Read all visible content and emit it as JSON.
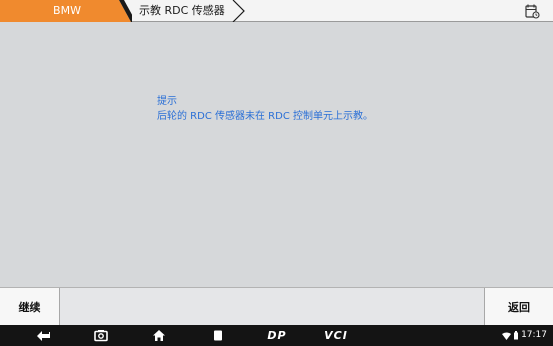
{
  "header": {
    "brand_label": "BMW",
    "page_title": "示教 RDC 传感器",
    "brand_color": "#f08a2e"
  },
  "message": {
    "title": "提示",
    "body": "后轮的 RDC 传感器未在 RDC 控制单元上示教。",
    "text_color": "#2a6fd6"
  },
  "actions": {
    "continue_label": "继续",
    "back_label": "返回"
  },
  "navbar": {
    "icons": [
      "back-icon",
      "camera-icon",
      "home-icon",
      "recent-apps-icon",
      "dp-icon",
      "vci-icon"
    ],
    "dp_label": "DP",
    "vci_label": "VCI"
  },
  "status": {
    "time": "17:17"
  }
}
